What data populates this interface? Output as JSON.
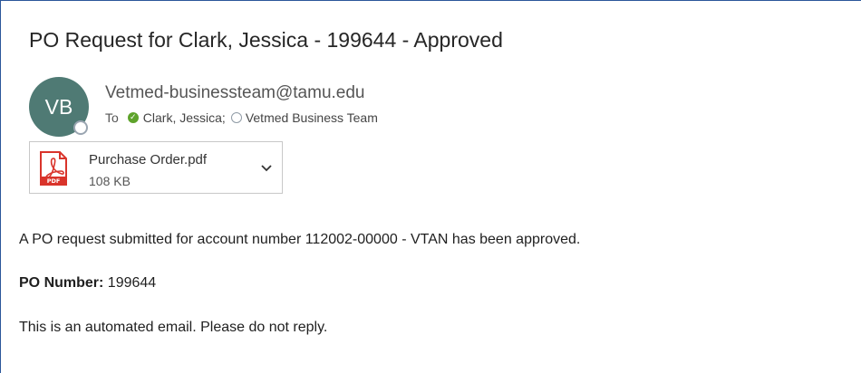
{
  "email": {
    "subject": "PO Request for Clark, Jessica - 199644 - Approved",
    "avatar_initials": "VB",
    "sender": "Vetmed-businessteam@tamu.edu",
    "to_label": "To",
    "recipients": [
      {
        "name": "Clark, Jessica;",
        "status": "available"
      },
      {
        "name": "Vetmed Business Team",
        "status": "offline"
      }
    ]
  },
  "attachment": {
    "name": "Purchase Order.pdf",
    "size": "108 KB",
    "icon": "pdf-file-icon",
    "icon_text": "PDF"
  },
  "body": {
    "line1": "A PO request submitted for account number 112002-00000 - VTAN has been approved.",
    "po_label": "PO Number:",
    "po_value": "199644",
    "line3": "This is an automated email. Please do not reply."
  },
  "colors": {
    "avatar_bg": "#4f7a74",
    "status_available": "#5ea32b",
    "pdf_red": "#d9342b",
    "frame_accent": "#2b579a"
  }
}
